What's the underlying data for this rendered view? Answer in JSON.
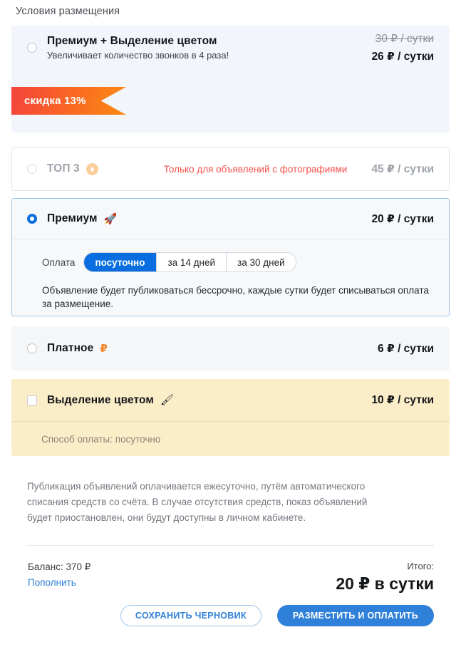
{
  "page": {
    "title": "Условия размещения"
  },
  "options": [
    {
      "id": "premium-plus-color",
      "title": "Премиум + Выделение цветом",
      "subtitle": "Увеличивает количество звонков в 4 раза!",
      "price_old": "30 ₽ / сутки",
      "price": "26 ₽ / сутки",
      "selected": false,
      "ribbon": "скидка 13%"
    },
    {
      "id": "top3",
      "title": "ТОП 3",
      "icon": "arrow-up-circle-icon",
      "warning": "Только для объявлений с фотографиями",
      "price": "45 ₽ / сутки",
      "selected": false,
      "disabled": true
    },
    {
      "id": "premium",
      "title": "Премиум",
      "icon": "rocket-icon",
      "price": "20 ₽ / сутки",
      "selected": true,
      "payment": {
        "label": "Оплата",
        "segments": [
          {
            "label": "посуточно",
            "active": true
          },
          {
            "label": "за 14 дней",
            "active": false
          },
          {
            "label": "за 30 дней",
            "active": false
          }
        ]
      },
      "note": "Объявление будет публиковаться бессрочно, каждые сутки будет списываться оплата за размещение."
    },
    {
      "id": "paid",
      "title": "Платное",
      "icon": "ruble-icon",
      "price": "6 ₽ / сутки",
      "selected": false
    },
    {
      "id": "color-highlight",
      "title": "Выделение цветом",
      "icon": "highlighter-icon",
      "price": "10 ₽ / сутки",
      "checked": false,
      "detail": "Способ оплаты: посуточно"
    }
  ],
  "info": "Публикация объявлений оплачивается ежесуточно, путём автоматического списания средств со счёта. В случае отсутствия средств, показ объявлений будет приостановлен, они будут доступны в личном кабинете.",
  "footer": {
    "balance": "Баланс: 370 ₽",
    "topup_link": "Пополнить",
    "total_label": "Итого:",
    "total_amount": "20 ₽ в сутки",
    "save_draft_button": "СОХРАНИТЬ ЧЕРНОВИК",
    "publish_button": "РАЗМЕСТИТЬ И ОПЛАТИТЬ"
  },
  "colors": {
    "accent_blue": "#2f80d8",
    "radio_blue": "#0a6ee0",
    "warning_red": "#f0524a",
    "ribbon_from": "#f4443c",
    "ribbon_to": "#fb8b12",
    "highlight_bg": "#fcedc9"
  }
}
